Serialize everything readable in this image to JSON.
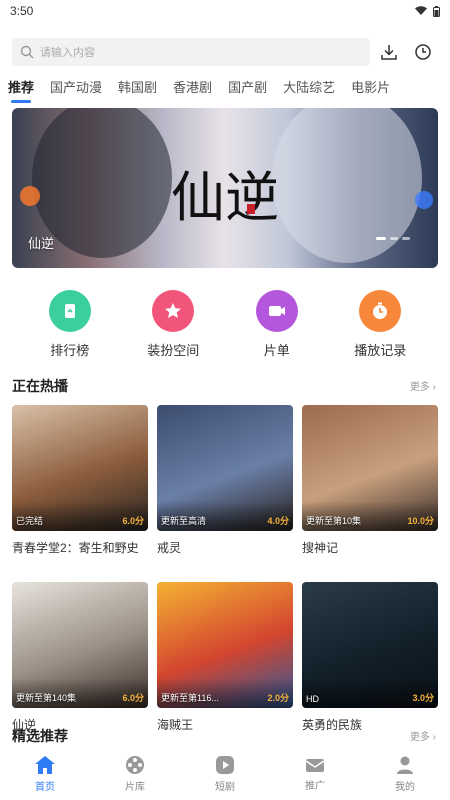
{
  "status": {
    "time": "3:50"
  },
  "search": {
    "placeholder": "请输入内容"
  },
  "tabs": [
    {
      "label": "推荐",
      "active": true
    },
    {
      "label": "国产动漫"
    },
    {
      "label": "韩国剧"
    },
    {
      "label": "香港剧"
    },
    {
      "label": "国产剧"
    },
    {
      "label": "大陆综艺"
    },
    {
      "label": "电影片"
    }
  ],
  "banner": {
    "caption": "仙逆",
    "calligraphy": "仙逆"
  },
  "shortcuts": [
    {
      "label": "排行榜",
      "color": "#3ccf9e",
      "icon": "ranking-icon"
    },
    {
      "label": "装扮空间",
      "color": "#f2557a",
      "icon": "star-icon"
    },
    {
      "label": "片单",
      "color": "#b457dd",
      "icon": "video-icon"
    },
    {
      "label": "播放记录",
      "color": "#f7873a",
      "icon": "timer-icon"
    }
  ],
  "hot": {
    "title": "正在热播",
    "more": "更多",
    "items": [
      {
        "title": "青春学堂2：寄生和野史",
        "status": "已完结",
        "score": "6.0分",
        "colors": [
          "#d9c1a8",
          "#8c5c3c",
          "#2a2623"
        ]
      },
      {
        "title": "戒灵",
        "status": "更新至高清",
        "score": "4.0分",
        "colors": [
          "#3b4c6d",
          "#6a7fa8",
          "#28221f"
        ]
      },
      {
        "title": "搜神记",
        "status": "更新至第10集",
        "score": "10.0分",
        "colors": [
          "#9b6b4e",
          "#c9a07d",
          "#3a2e2a"
        ]
      },
      {
        "title": "仙逆",
        "status": "更新至第140集",
        "score": "6.0分",
        "colors": [
          "#e7e3dc",
          "#9a8f85",
          "#3b2f2a"
        ]
      },
      {
        "title": "海贼王",
        "status": "更新至第116...",
        "score": "2.0分",
        "colors": [
          "#f5b233",
          "#d3452f",
          "#2b5a9b"
        ]
      },
      {
        "title": "英勇的民族",
        "status": "HD",
        "score": "3.0分",
        "colors": [
          "#2a3c48",
          "#12202a",
          "#0a1016"
        ]
      }
    ]
  },
  "featured": {
    "title": "精选推荐",
    "more": "更多"
  },
  "bottom_nav": [
    {
      "label": "首页",
      "icon": "home-icon",
      "active": true
    },
    {
      "label": "片库",
      "icon": "film-reel-icon"
    },
    {
      "label": "短剧",
      "icon": "play-icon"
    },
    {
      "label": "推广",
      "icon": "mail-icon"
    },
    {
      "label": "我的",
      "icon": "user-icon"
    }
  ]
}
